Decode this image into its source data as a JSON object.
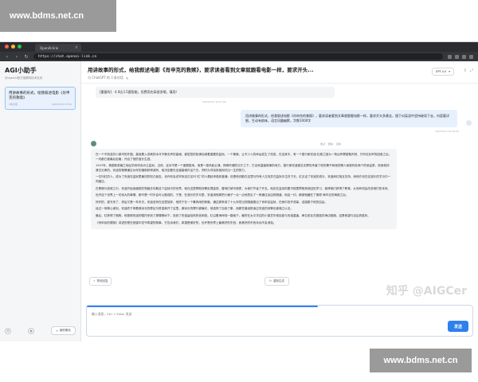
{
  "watermark": {
    "top": "www.bdms.net.cn",
    "bottom": "www.bdms.net.cn",
    "zhihu": "知乎 @AIGCer"
  },
  "browser": {
    "tab_title": "OpenAI-link",
    "url": "https://chat.openai-link.cn"
  },
  "sidebar": {
    "title": "AGI小助手",
    "subtitle": "@openAI官方接模特技术支持",
    "items": [
      {
        "label": "用讲故事的形式，绘我叙述电影《肖申克的救赎》",
        "count": "3条对话",
        "date": "2023/5/15 07:50"
      }
    ],
    "new_chat": "新的聊天"
  },
  "header": {
    "title": "用讲故事的形式，给我叙述电影《肖申克的救赎》，要求读者看到文章就跟看电影一样，要求开头...",
    "subtitle": "与 ChatGPT 的 3 条对话",
    "model": "GPT-4.0"
  },
  "messages": {
    "system": "[重要的] · 4.0比3.5要智能，但费用也高很多哦，慎用！",
    "system_time": "2023/5/15 10:57:09",
    "user": "用讲故事的形式，给我叙述电影《肖申克的救赎》，要求读者看到文章就跟看电影一样，要求开头多悬念，镜下对英语中坚持继续下去，内容要详细，生动有韵味，语言风趣幽默，字数1000字",
    "user_time": "2023/5/15 10:55:09",
    "bot_actions": [
      "重试",
      "删除",
      "复制"
    ],
    "bot_paragraphs": [
      "在一个不知名的小镇市的外围，高耸着入流离的冰冷不静无声的高墙，被层层的松弹包城着重要的监狱。一个悬案，让不少人的命运发生了改变。在这其中，有一个银行家安迪·杜弗兰因为一场凶杀罪被冤判刑，只听见铃声的回音之后，一切都已被最后定格，开启了他的漫长生涯。",
      "1947年，美国新英格兰地区的肖申克州立监狱。当然，这对不是一个度假胜地，而是一座风起云涌、杨梆听潮的汉厅之下，打出他温馨故事的地方。银行家安迪被告无罪但杀害了他的妻子和她的情人而被判处两个终身监禁，然而他却清白无辜的。安迪的冤情通过伙伴的援助获得减刑，他决定要在这道高墙内活下去，同时为寻找真相而付出一生的努力。",
      "一位叫红的人，成为了安迪在监狱里最初的知己朋友。也许你会说牢狱这位名叫“红”的人看起来极其普通，但是他却能在这里与所有人交流并在监狱中生存下去。红见证了安迪的成长，安迪和红相互扶持，而他们也在这漫长的岁月中一同度过。",
      "在黑暗与孤寂之中，安迪开始用细腻的笔触去勾勒这个监狱中的世界。他在这里帮助狱警处理金钱，替他们填写税表，为他们节省了开支。他还在监狱的图书馆里帮助其他囚犯学习，使得他们获得了教育，从而有机会改变他们的未来。",
      "也许这个世界上一切伟大的事情，都不是一时半会可以做成的。于是，在漫长的岁月里，安迪用他那把小锤子一点一点地挖出了一条通往自由的隧道。而这一切，都被他藏在了丽塔·海华丝的海报之后。",
      "好好的，夏天来了，然后又是一年冬天。安迪没有在这里放弃，他终于在一个暴风雨的夜晚，通过那条用了十九年挖出的隧道爬出了肖申克监狱，在雨中张开双臂，迎接属于他的自由。",
      "经过一场精心谋划，安迪终于带着典狱长的罪证与财富离开了这里。典狱长的罪行被曝光，他选择了自我了断，而那些曾经欺凌过安迪的狱警也被绳之以法。",
      "最后，红获得了假释，他按照安迪的嘱托来到了那棵橡树下，找到了安迪留给他的信和钱。红沿着海岸线一路南下，最终在太平洋边的小镇芝华塔尼欧与安迪重逢。两位老友在蔚蓝的海边相拥，这是希望与自由的胜利。",
      "《肖申克的救赎》讲述的是在绝望中坚守希望的故事。它告诉我们，希望是美好的，也许是世界上最美好的东西，而美好的东西永远不会消逝。"
    ],
    "regenerate": "重新生成"
  },
  "composer": {
    "reply_tag": "预设回复",
    "placeholder": "输入消息，Ctrl + Enter 发送",
    "send": "发送",
    "progress": 0.6
  }
}
